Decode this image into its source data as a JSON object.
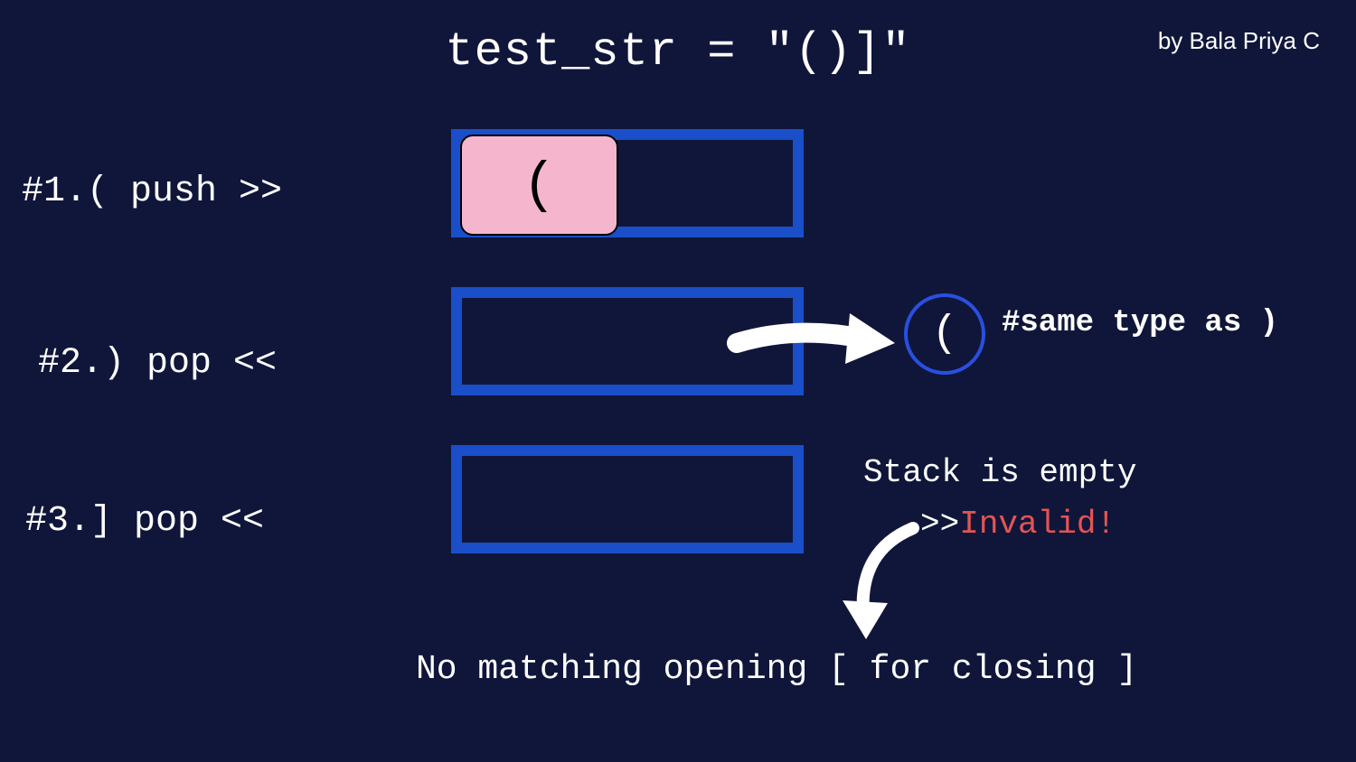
{
  "title": "test_str = \"()]\"",
  "byline": "by Bala Priya C",
  "steps": {
    "s1": {
      "label": "#1.( push >>",
      "cell": "("
    },
    "s2": {
      "label": "#2.) pop <<",
      "popped": "(",
      "comment": "#same type as )"
    },
    "s3": {
      "label": "#3.] pop <<"
    }
  },
  "result": {
    "empty": "Stack is empty",
    "arrows": ">>",
    "invalid": "Invalid!",
    "bottom": "No matching opening [ for closing ]"
  }
}
